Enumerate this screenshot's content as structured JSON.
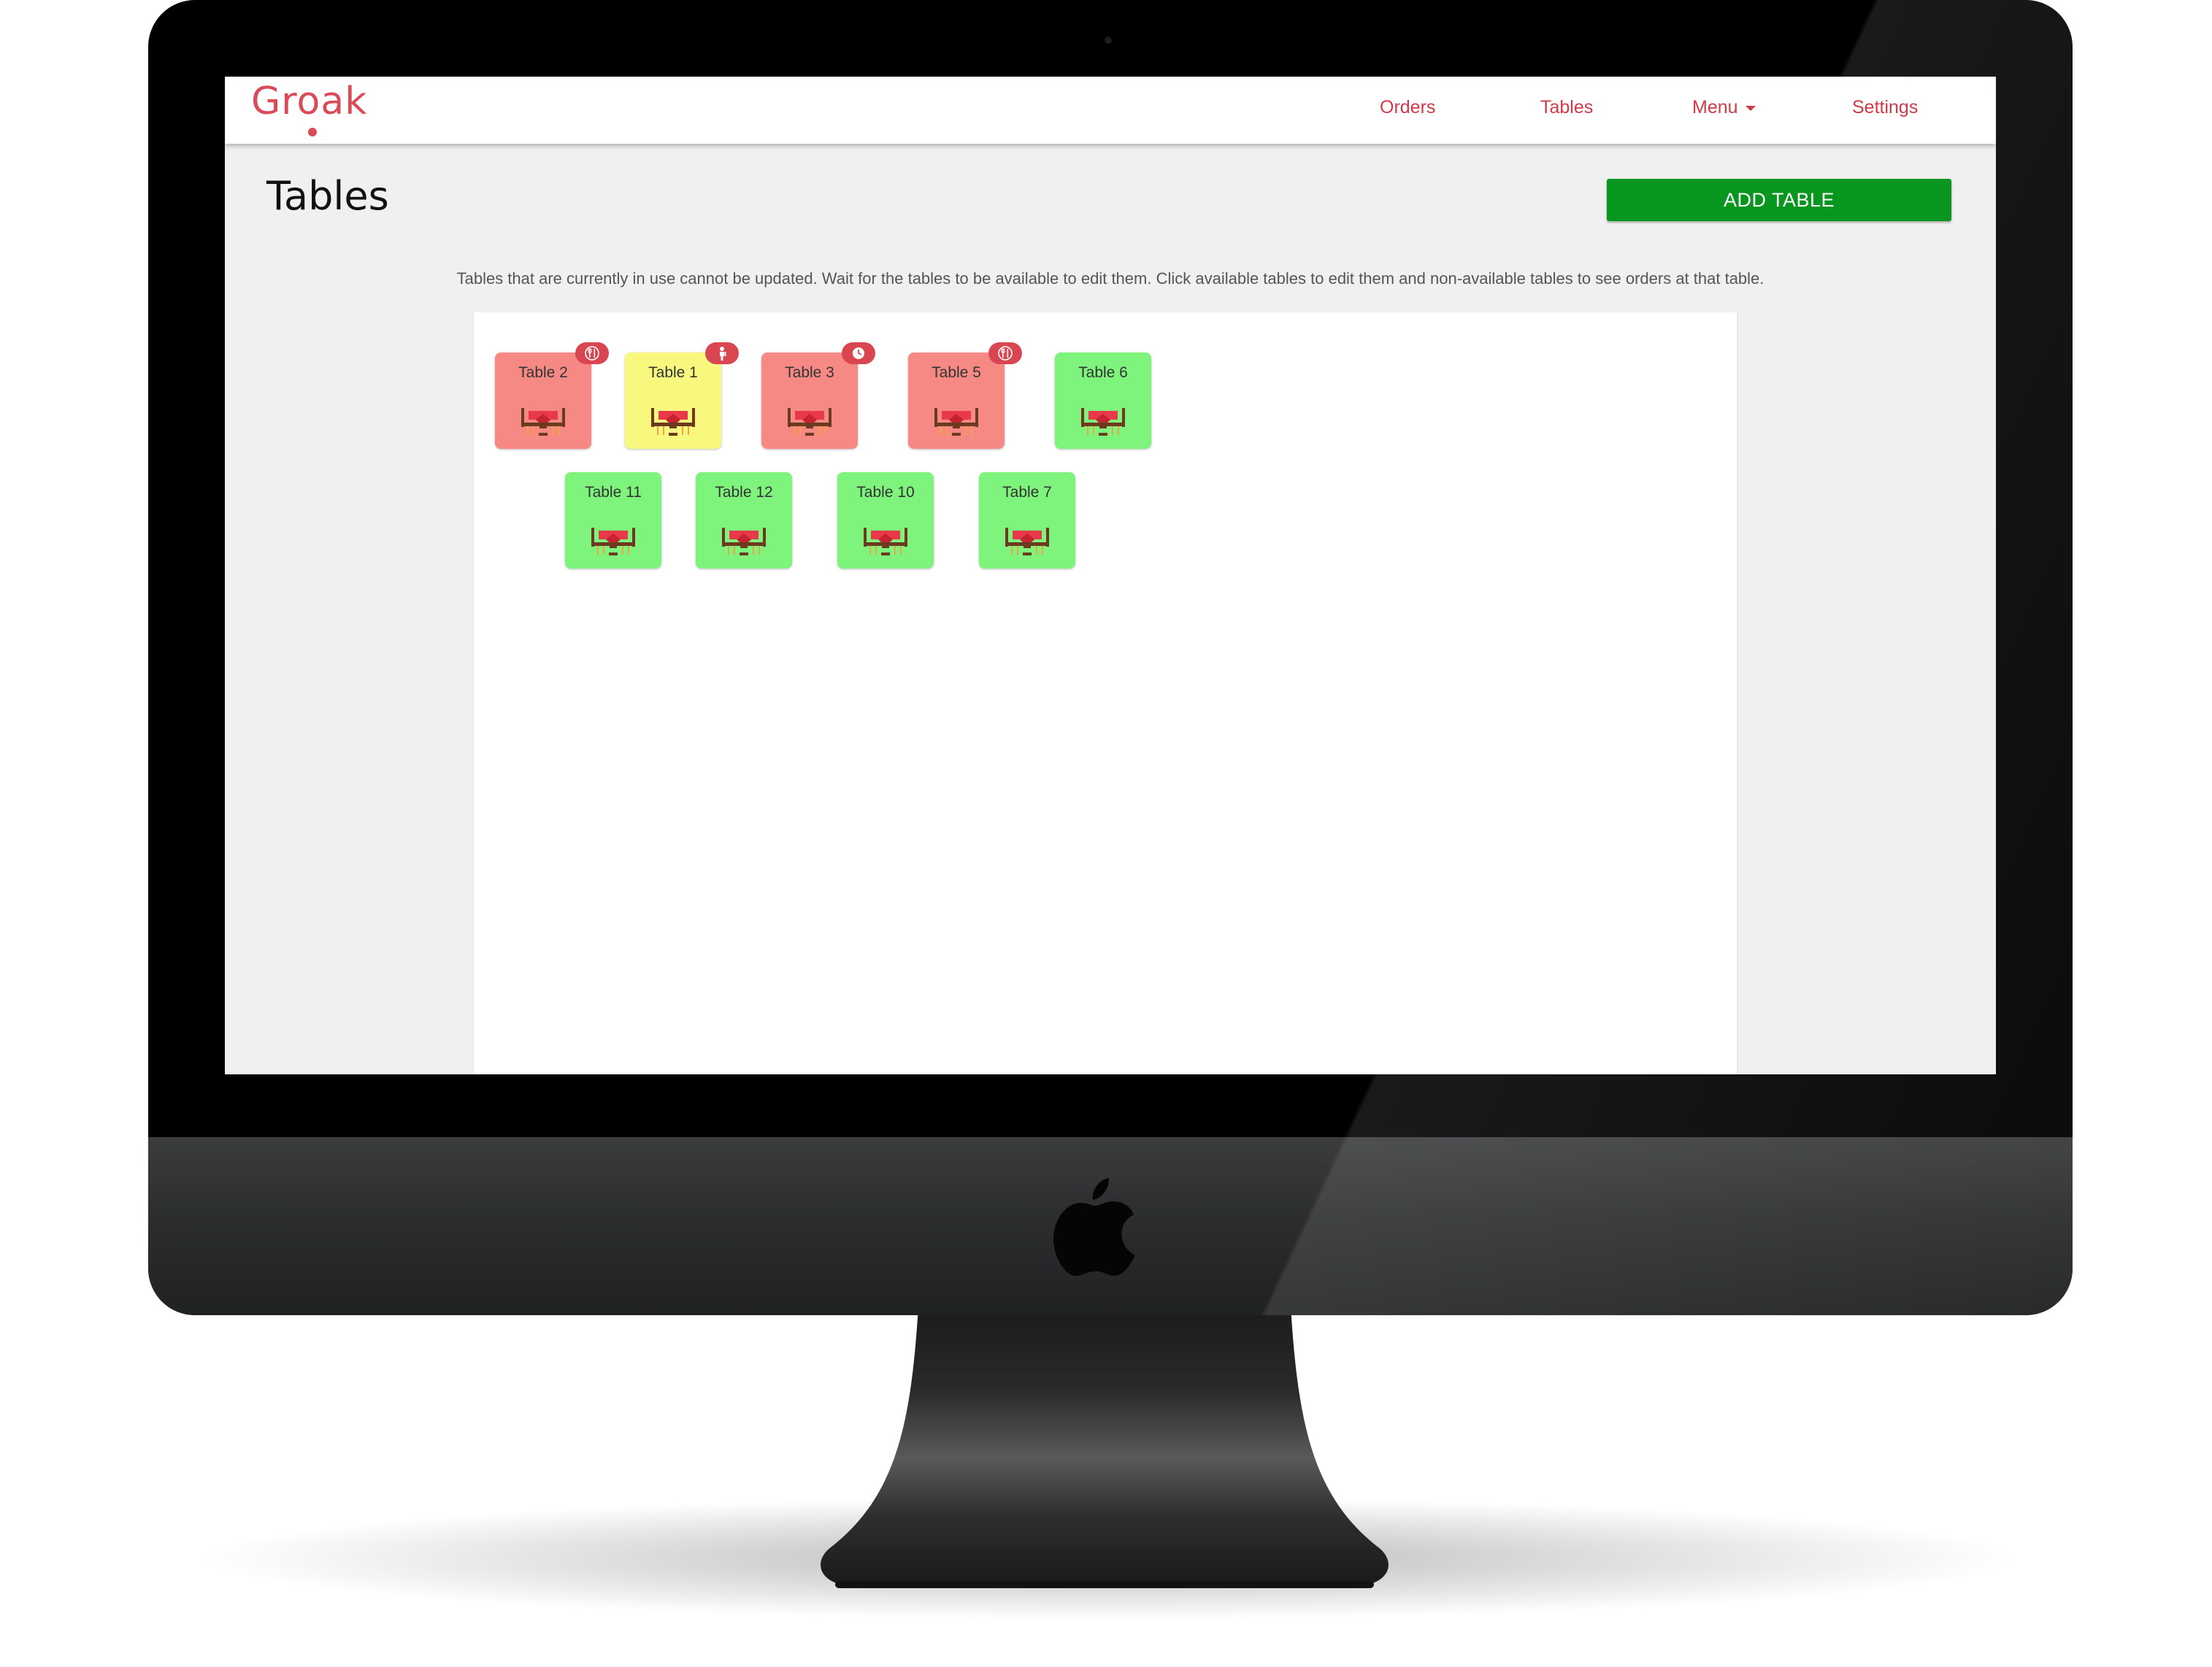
{
  "navbar": {
    "brand": "Groak",
    "links": [
      {
        "label": "Orders"
      },
      {
        "label": "Tables"
      },
      {
        "label": "Menu"
      },
      {
        "label": "Settings"
      }
    ]
  },
  "page": {
    "title": "Tables",
    "add_button_label": "ADD TABLE",
    "info_text": "Tables that are currently in use cannot be updated. Wait for the tables to be available to edit them. Click available tables to edit them and non-available tables to see orders at that table."
  },
  "tables": [
    {
      "name": "Table 2",
      "status": "occupied",
      "badge": "utensils-icon"
    },
    {
      "name": "Table 1",
      "status": "waiting",
      "badge": "waiter-icon"
    },
    {
      "name": "Table 3",
      "status": "occupied",
      "badge": "clock-icon"
    },
    {
      "name": "Table 5",
      "status": "occupied",
      "badge": "utensils-icon"
    },
    {
      "name": "Table 6",
      "status": "available",
      "badge": null
    },
    {
      "name": "Table 11",
      "status": "available",
      "badge": null
    },
    {
      "name": "Table 12",
      "status": "available",
      "badge": null
    },
    {
      "name": "Table 10",
      "status": "available",
      "badge": null
    },
    {
      "name": "Table 7",
      "status": "available",
      "badge": null
    }
  ],
  "colors": {
    "brand": "#d94b57",
    "occupied": "#f78985",
    "waiting": "#f8f77e",
    "available": "#7ef47d",
    "add_button": "#08961f"
  }
}
